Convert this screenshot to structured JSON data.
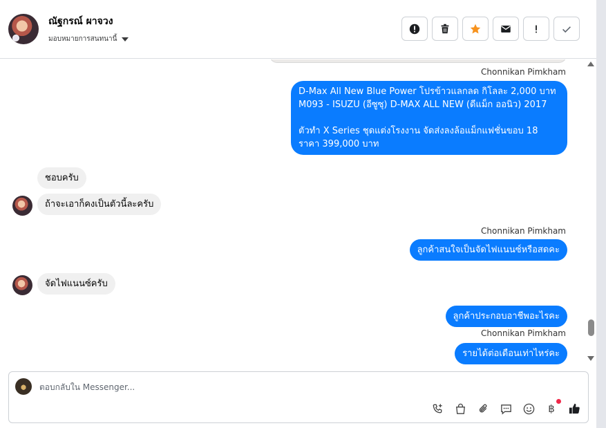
{
  "header": {
    "contact_name": "ณัฐกรณ์ ผาจวง",
    "assign_label": "มอบหมายการสนทนานี้",
    "toolbar": [
      {
        "name": "spam-button",
        "icon": "exclamation-circle-icon"
      },
      {
        "name": "delete-button",
        "icon": "trash-icon"
      },
      {
        "name": "star-button",
        "icon": "star-icon",
        "color": "#f7931e"
      },
      {
        "name": "mark-unread-button",
        "icon": "envelope-icon"
      },
      {
        "name": "important-button",
        "icon": "exclamation-icon"
      },
      {
        "name": "done-button",
        "icon": "check-icon"
      }
    ]
  },
  "thread": {
    "messages": [
      {
        "sender": "Chonnikan Pimkham",
        "direction": "out",
        "lines": [
          "D-Max All New Blue Power โปรข้าวแลกลด กิโลละ 2,000 บาท",
          "M093 - ISUZU (อีซูซุ) D-MAX ALL NEW (ดีแม็ก ออนิว) 2017",
          "",
          " ตัวทำ X Series ชุดแต่งโรงงาน จัดส่งลงล้อแม็กแฟชั่นขอบ 18",
          "ราคา 399,000 บาท"
        ]
      },
      {
        "direction": "in",
        "text": "ชอบครับ"
      },
      {
        "direction": "in",
        "text": "ถ้าจะเอาก็คงเป็นตัวนี้ละครับ"
      },
      {
        "sender": "Chonnikan Pimkham",
        "direction": "out",
        "text": "ลูกค้าสนใจเป็นจัดไฟแนนซ์หรือสดคะ"
      },
      {
        "direction": "in",
        "text": "จัดไฟแนนซ์ครับ"
      },
      {
        "direction": "out",
        "text": "ลูกค้าประกอบอาชีพอะไรคะ"
      },
      {
        "sender": "Chonnikan Pimkham",
        "direction": "out",
        "text": "รายได้ต่อเดือนเท่าไหร่คะ"
      }
    ]
  },
  "composer": {
    "placeholder": "ตอบกลับใน Messenger...",
    "tools": [
      "phone-plus-icon",
      "shopping-bag-icon",
      "paperclip-icon",
      "chat-bubble-icon",
      "smiley-icon",
      "baht-icon",
      "thumbs-up-icon"
    ],
    "baht_symbol": "฿"
  },
  "colors": {
    "accent": "#0a7cff",
    "incoming_bubble": "#f0f0f0",
    "star": "#f7931e",
    "notification_dot": "#f02849"
  }
}
